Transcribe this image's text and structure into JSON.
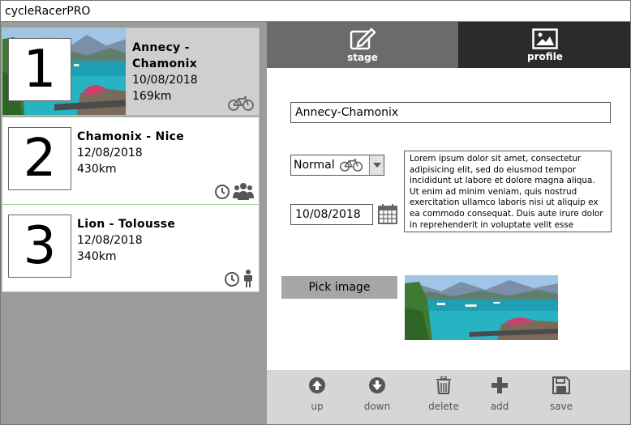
{
  "app": {
    "title": "cycleRacerPRO"
  },
  "stages": [
    {
      "number": "1",
      "route": "Annecy - Chamonix",
      "date": "10/08/2018",
      "distance": "169km",
      "icons": [
        "bicycle-icon"
      ]
    },
    {
      "number": "2",
      "route": "Chamonix - Nice",
      "date": "12/08/2018",
      "distance": "430km",
      "icons": [
        "clock-icon",
        "group-icon"
      ]
    },
    {
      "number": "3",
      "route": "Lion - Tolousse",
      "date": "12/08/2018",
      "distance": "340km",
      "icons": [
        "clock-icon",
        "person-icon"
      ]
    }
  ],
  "tabs": [
    {
      "label": "stage",
      "icon": "edit-icon"
    },
    {
      "label": "profile",
      "icon": "image-icon"
    }
  ],
  "form": {
    "name": "Annecy-Chamonix",
    "type": "Normal",
    "type_icon": "bicycle-icon",
    "date": "10/08/2018",
    "description": "Lorem ipsum dolor sit amet, consectetur adipisicing elit, sed do eiusmod tempor incididunt ut labore et dolore magna aliqua. Ut enim ad minim veniam, quis nostrud exercitation ullamco laboris nisi ut aliquip ex ea commodo consequat. Duis aute irure dolor in reprehenderit in voluptate velit esse",
    "pick_image": "Pick image"
  },
  "toolbar": {
    "up": "up",
    "down": "down",
    "delete": "delete",
    "add": "add",
    "save": "save"
  },
  "colors": {
    "selected_card": "#cfcfcf",
    "card_border": "#a6cf9f",
    "tab_active": "#2b2b2b",
    "tab_inactive": "#6b6b6b",
    "left_background": "#9b9b9b",
    "toolbar_background": "#d6d6d6"
  }
}
